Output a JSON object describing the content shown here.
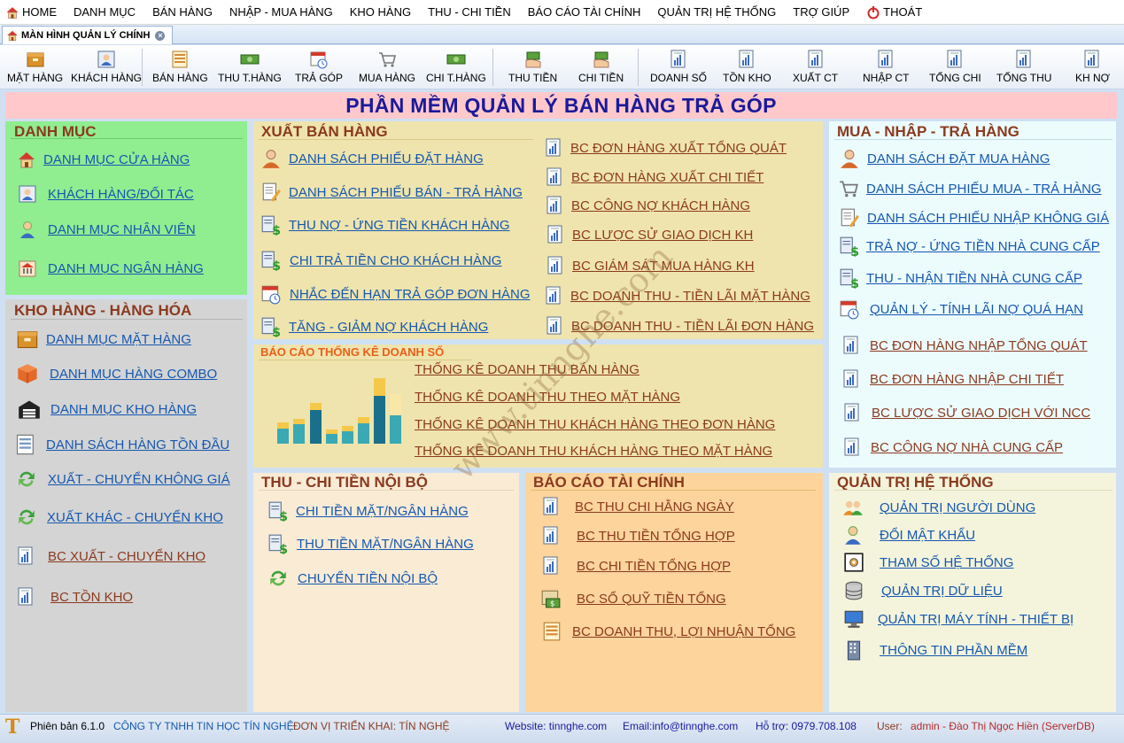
{
  "menu": {
    "home": "HOME",
    "danh_muc": "DANH MỤC",
    "ban_hang": "BÁN HÀNG",
    "nhap_mua": "NHẬP - MUA HÀNG",
    "kho_hang": "KHO HÀNG",
    "thu_chi": "THU - CHI TIỀN",
    "bao_cao": "BÁO CÁO TÀI CHÍNH",
    "quan_tri": "QUẢN TRỊ HỆ THỐNG",
    "tro_giup": "TRỢ GIÚP",
    "thoat": "THOÁT"
  },
  "tab": {
    "label": "MÀN HÌNH QUẢN LÝ CHÍNH",
    "close": "×"
  },
  "toolbar": {
    "mat_hang": "MẶT HÀNG",
    "khach_hang": "KHÁCH HÀNG",
    "ban_hang": "BÁN HÀNG",
    "thu_t_hang": "THU T.HÀNG",
    "tra_gop": "TRẢ GÓP",
    "mua_hang": "MUA HÀNG",
    "chi_t_hang": "CHI T.HÀNG",
    "thu_tien": "THU TIỀN",
    "chi_tien": "CHI TIỀN",
    "doanh_so": "DOANH SỐ",
    "ton_kho": "TỒN KHO",
    "xuat_ct": "XUẤT CT",
    "nhap_ct": "NHẬP CT",
    "tong_chi": "TỔNG CHI",
    "tong_thu": "TỔNG THU",
    "kh_no": "KH NỢ"
  },
  "title": "PHẦN MỀM QUẢN LÝ BÁN HÀNG TRẢ GÓP",
  "danh_muc": {
    "title": "DANH MỤC",
    "items": [
      "DANH MỤC CỬA HÀNG",
      "KHÁCH HÀNG/ĐỐI TÁC",
      "DANH MỤC NHÂN VIÊN",
      "DANH MỤC NGÂN HÀNG"
    ]
  },
  "kho_hang": {
    "title": "KHO HÀNG - HÀNG HÓA",
    "items": [
      "DANH MỤC MẶT HÀNG",
      "DANH MỤC HÀNG COMBO",
      "DANH MỤC KHO HÀNG",
      "DANH SÁCH HÀNG TỒN ĐẦU",
      "XUẤT - CHUYỂN KHÔNG GIÁ",
      "XUẤT KHÁC - CHUYỂN KHO",
      "BC XUẤT - CHUYỂN KHO",
      "BC TỒN KHO"
    ]
  },
  "xuat_ban": {
    "title": "XUẤT BÁN HÀNG",
    "left": [
      "DANH SÁCH PHIẾU ĐẶT HÀNG",
      "DANH SÁCH PHIẾU BÁN - TRẢ HÀNG",
      "THU NỢ - ỨNG TIỀN KHÁCH HÀNG",
      "CHI TRẢ TIỀN CHO KHÁCH HÀNG",
      "NHẮC ĐẾN HẠN TRẢ GÓP ĐƠN HÀNG",
      "TĂNG - GIẢM NỢ KHÁCH HÀNG"
    ],
    "right": [
      "BC ĐƠN HÀNG XUẤT TỔNG QUÁT",
      "BC ĐƠN HÀNG XUẤT CHI TIẾT",
      "BC CÔNG NỢ KHÁCH HÀNG",
      "BC LƯỢC SỬ GIAO DỊCH KH",
      "BC GIÁM SÁT MUA HÀNG KH",
      "BC DOANH THU - TIỀN LÃI MẶT HÀNG",
      "BC DOANH THU - TIỀN LÃI ĐƠN HÀNG"
    ]
  },
  "bao_cao_ds": {
    "title": "BÁO CÁO THỐNG KÊ DOANH SỐ",
    "items": [
      "THỐNG KÊ DOANH THU BÁN HÀNG",
      "THỐNG KÊ DOANH THU THEO MẶT HÀNG",
      "THỐNG KÊ DOANH THU KHÁCH HÀNG THEO ĐƠN HÀNG",
      "THỐNG KÊ DOANH THU KHÁCH HÀNG THEO MẶT HÀNG"
    ]
  },
  "mua_nhap": {
    "title": "MUA - NHẬP - TRẢ HÀNG",
    "items": [
      "DANH SÁCH ĐẶT MUA HÀNG",
      "DANH SÁCH PHIẾU MUA - TRẢ HÀNG",
      "DANH SÁCH PHIẾU NHẬP KHÔNG GIÁ",
      "TRẢ NỢ - ỨNG TIỀN NHÀ CUNG CẤP",
      "THU - NHẬN TIỀN NHÀ CUNG CẤP",
      "QUẢN LÝ - TÍNH LÃI  NỢ QUÁ HẠN",
      "BC ĐƠN HÀNG NHẬP TỔNG QUÁT",
      "BC ĐƠN HÀNG NHẬP CHI TIẾT",
      "BC LƯỢC SỬ GIAO DỊCH VỚI NCC",
      "BC CÔNG NỢ NHÀ CUNG CẤP"
    ]
  },
  "thu_chi": {
    "title": "THU - CHI TIỀN NỘI BỘ",
    "items": [
      "CHI TIỀN MẶT/NGÂN HÀNG",
      "THU TIỀN MẶT/NGÂN HÀNG",
      "CHUYỂN TIỀN NỘI BỘ"
    ]
  },
  "bao_cao_tc": {
    "title": "BÁO CÁO TÀI CHÍNH",
    "items": [
      "BC THU CHI HẰNG NGÀY",
      "BC THU TIỀN TỔNG HỢP",
      "BC CHI TIỀN TỔNG HỢP",
      "BC SỔ QUỸ TIỀN TỔNG",
      "BC DOANH THU, LỢI NHUẬN TỔNG"
    ]
  },
  "quan_tri": {
    "title": "QUẢN TRỊ HỆ THỐNG",
    "items": [
      "QUẢN TRỊ NGƯỜI DÙNG",
      "ĐỔI MẬT KHẨU",
      "THAM SỐ HỆ THỐNG",
      "QUẢN TRỊ DỮ LIỆU",
      "QUẢN TRỊ MÁY TÍNH - THIẾT BỊ",
      "THÔNG TIN PHẦN MỀM"
    ]
  },
  "watermark": "www.tinnghe.com",
  "footer": {
    "logo": "T",
    "version": "Phiên bản 6.1.0",
    "company": "CÔNG TY TNHH TIN HỌC TÍN NGHỆ",
    "unit": "ĐƠN VỊ TRIỂN KHAI: TÍN NGHỆ",
    "website": "Website: tinnghe.com",
    "email": "Email:info@tinnghe.com",
    "support": "Hỗ trợ: 0979.708.108",
    "user_label": "User:",
    "user_value": "admin - Đào Thị Ngọc Hiền (ServerDB)"
  },
  "colors": {
    "danh_muc_bg": "#90ee90",
    "kho_bg": "#d4d4d4",
    "xuat_bg": "#efe4ad",
    "mua_bg": "#ecfcfd",
    "thu_chi_bg": "#faebd5",
    "bao_cao_tc_bg": "#fcd49c",
    "quan_tri_bg": "#f4f4dc",
    "title_bg": "#ffc9cc",
    "link_blue": "#1558b0",
    "link_brown": "#8b3a1f"
  }
}
